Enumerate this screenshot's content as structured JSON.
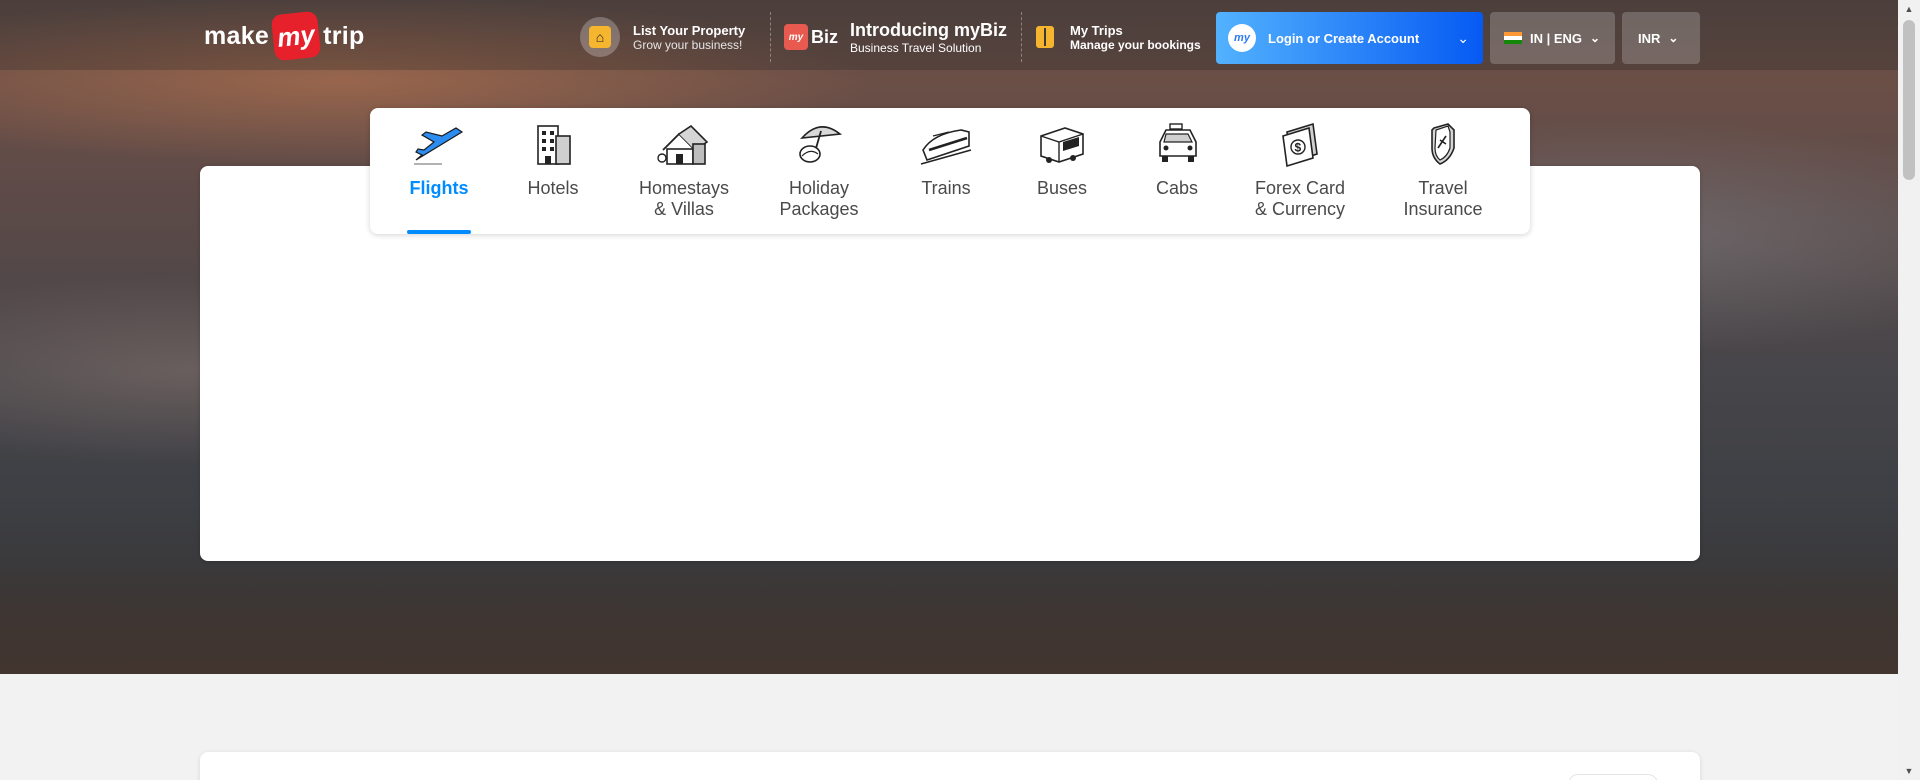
{
  "header": {
    "logo": {
      "left": "make",
      "middle": "my",
      "right": "trip"
    },
    "list_property": {
      "title": "List Your Property",
      "subtitle": "Grow your business!"
    },
    "mybiz": {
      "badge": "Biz",
      "title": "Introducing myBiz",
      "subtitle": "Business Travel Solution"
    },
    "my_trips": {
      "title": "My Trips",
      "subtitle": "Manage your bookings"
    },
    "login": {
      "avatar": "my",
      "label": "Login or Create Account"
    },
    "language": {
      "label": "IN | ENG"
    },
    "currency": {
      "label": "INR"
    }
  },
  "tabs": [
    {
      "label": "Flights",
      "icon": "airplane-icon",
      "active": true
    },
    {
      "label": "Hotels",
      "icon": "hotel-building-icon",
      "active": false
    },
    {
      "label": "Homestays\n& Villas",
      "icon": "villa-house-icon",
      "active": false
    },
    {
      "label": "Holiday\nPackages",
      "icon": "beach-umbrella-icon",
      "active": false
    },
    {
      "label": "Trains",
      "icon": "train-icon",
      "active": false
    },
    {
      "label": "Buses",
      "icon": "bus-icon",
      "active": false
    },
    {
      "label": "Cabs",
      "icon": "cab-icon",
      "active": false
    },
    {
      "label": "Forex Card\n& Currency",
      "icon": "forex-card-icon",
      "active": false
    },
    {
      "label": "Travel\nInsurance",
      "icon": "insurance-shield-icon",
      "active": false
    }
  ],
  "colors": {
    "accent": "#008cff",
    "login_start": "#53b2fe",
    "login_end": "#065af3",
    "logo_red": "#e7212b"
  }
}
